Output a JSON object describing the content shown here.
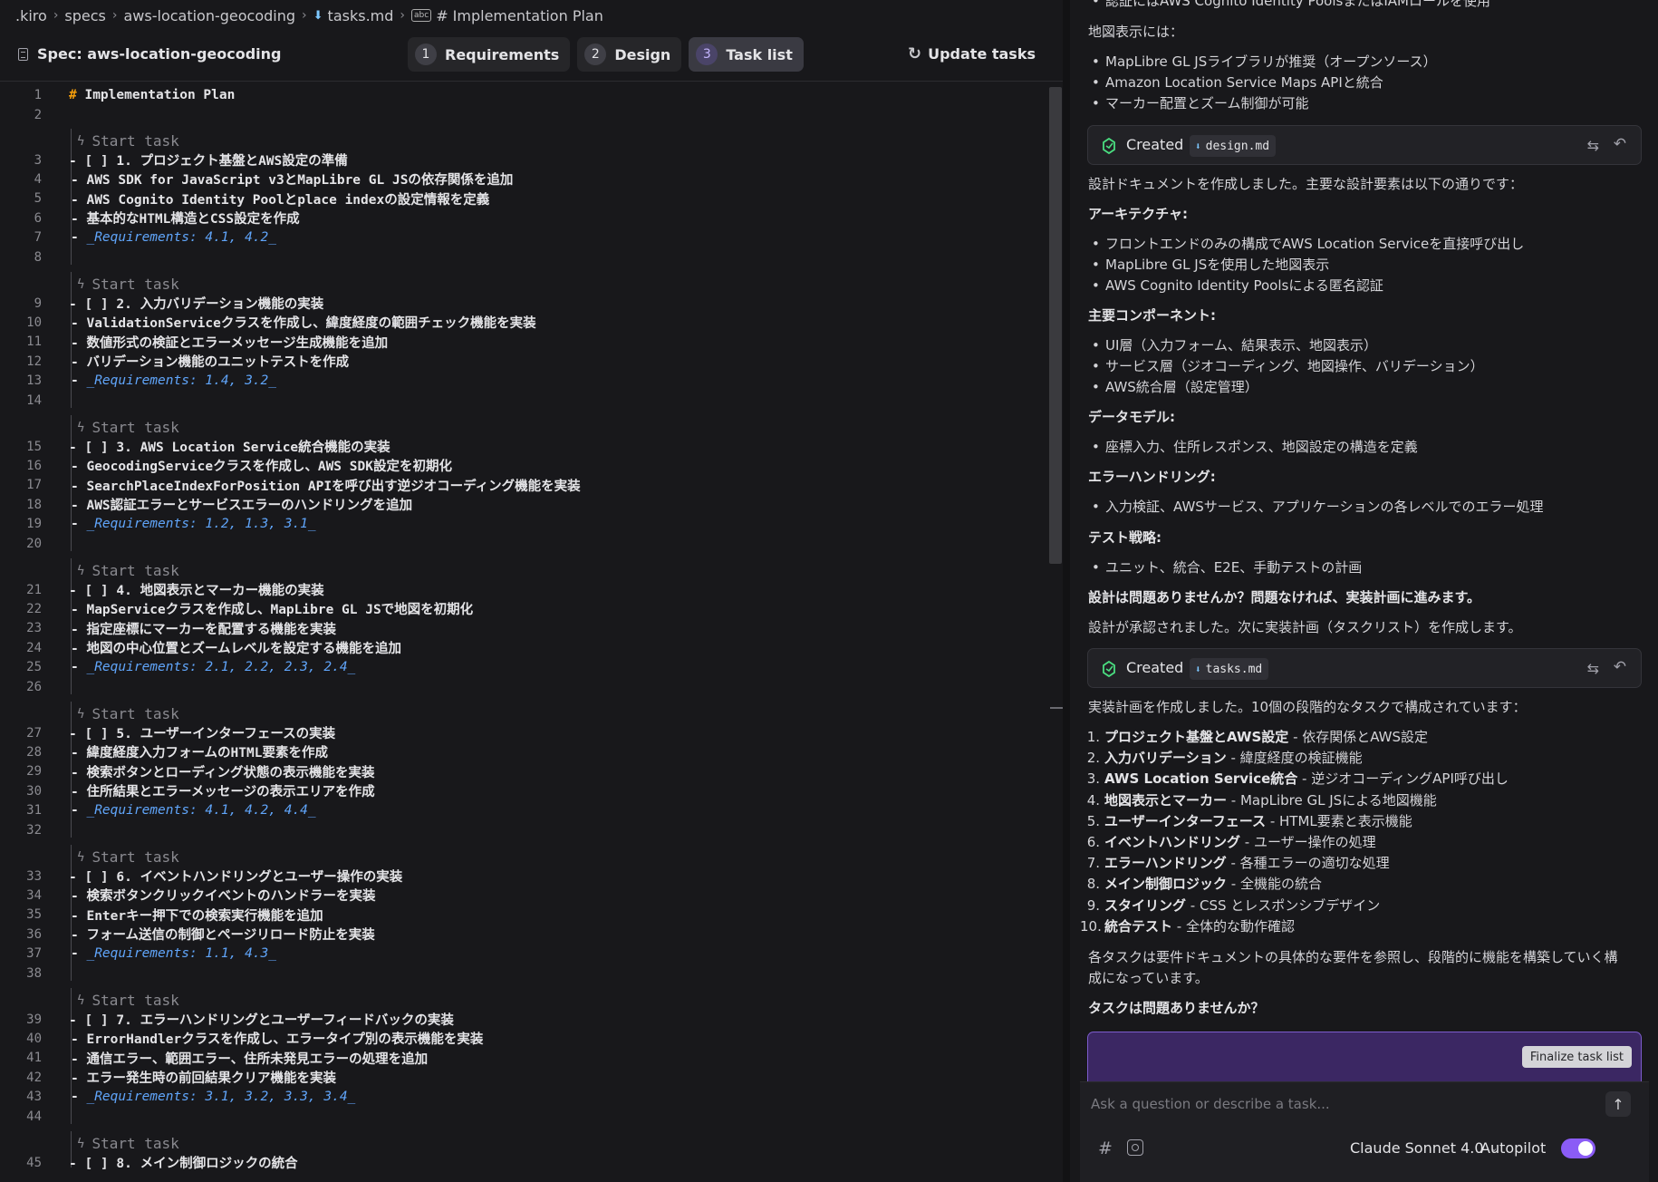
{
  "breadcrumb": [
    ".kiro",
    "specs",
    "aws-location-geocoding",
    "tasks.md",
    "# Implementation Plan"
  ],
  "spec": {
    "title": "Spec: aws-location-geocoding",
    "tabs": [
      {
        "num": "1",
        "label": "Requirements"
      },
      {
        "num": "2",
        "label": "Design"
      },
      {
        "num": "3",
        "label": "Task list"
      }
    ],
    "update_label": "Update tasks"
  },
  "editor": {
    "codelens": "Start task",
    "lines": [
      {
        "n": "1",
        "text": "# Implementation Plan"
      },
      {
        "n": "2",
        "text": ""
      },
      {
        "n": "3",
        "text": "- [ ] 1. プロジェクト基盤とAWS設定の準備"
      },
      {
        "n": "4",
        "text": "- AWS SDK for JavaScript v3とMapLibre GL JSの依存関係を追加"
      },
      {
        "n": "5",
        "text": "- AWS Cognito Identity Poolとplace indexの設定情報を定義"
      },
      {
        "n": "6",
        "text": "- 基本的なHTML構造とCSS設定を作成"
      },
      {
        "n": "7",
        "text": "_Requirements: 4.1, 4.2_"
      },
      {
        "n": "8",
        "text": ""
      },
      {
        "n": "9",
        "text": "- [ ] 2. 入力バリデーション機能の実装"
      },
      {
        "n": "10",
        "text": "- ValidationServiceクラスを作成し、緯度経度の範囲チェック機能を実装"
      },
      {
        "n": "11",
        "text": "- 数値形式の検証とエラーメッセージ生成機能を追加"
      },
      {
        "n": "12",
        "text": "- バリデーション機能のユニットテストを作成"
      },
      {
        "n": "13",
        "text": "_Requirements: 1.4, 3.2_"
      },
      {
        "n": "14",
        "text": ""
      },
      {
        "n": "15",
        "text": "- [ ] 3. AWS Location Service統合機能の実装"
      },
      {
        "n": "16",
        "text": "- GeocodingServiceクラスを作成し、AWS SDK設定を初期化"
      },
      {
        "n": "17",
        "text": "- SearchPlaceIndexForPosition APIを呼び出す逆ジオコーディング機能を実装"
      },
      {
        "n": "18",
        "text": "- AWS認証エラーとサービスエラーのハンドリングを追加"
      },
      {
        "n": "19",
        "text": "_Requirements: 1.2, 1.3, 3.1_"
      },
      {
        "n": "20",
        "text": ""
      },
      {
        "n": "21",
        "text": "- [ ] 4. 地図表示とマーカー機能の実装"
      },
      {
        "n": "22",
        "text": "- MapServiceクラスを作成し、MapLibre GL JSで地図を初期化"
      },
      {
        "n": "23",
        "text": "- 指定座標にマーカーを配置する機能を実装"
      },
      {
        "n": "24",
        "text": "- 地図の中心位置とズームレベルを設定する機能を追加"
      },
      {
        "n": "25",
        "text": "_Requirements: 2.1, 2.2, 2.3, 2.4_"
      },
      {
        "n": "26",
        "text": ""
      },
      {
        "n": "27",
        "text": "- [ ] 5. ユーザーインターフェースの実装"
      },
      {
        "n": "28",
        "text": "- 緯度経度入力フォームのHTML要素を作成"
      },
      {
        "n": "29",
        "text": "- 検索ボタンとローディング状態の表示機能を実装"
      },
      {
        "n": "30",
        "text": "- 住所結果とエラーメッセージの表示エリアを作成"
      },
      {
        "n": "31",
        "text": "_Requirements: 4.1, 4.2, 4.4_"
      },
      {
        "n": "32",
        "text": ""
      },
      {
        "n": "33",
        "text": "- [ ] 6. イベントハンドリングとユーザー操作の実装"
      },
      {
        "n": "34",
        "text": "- 検索ボタンクリックイベントのハンドラーを実装"
      },
      {
        "n": "35",
        "text": "- Enterキー押下での検索実行機能を追加"
      },
      {
        "n": "36",
        "text": "- フォーム送信の制御とページリロード防止を実装"
      },
      {
        "n": "37",
        "text": "_Requirements: 1.1, 4.3_"
      },
      {
        "n": "38",
        "text": ""
      },
      {
        "n": "39",
        "text": "- [ ] 7. エラーハンドリングとユーザーフィードバックの実装"
      },
      {
        "n": "40",
        "text": "- ErrorHandlerクラスを作成し、エラータイプ別の表示機能を実装"
      },
      {
        "n": "41",
        "text": "- 通信エラー、範囲エラー、住所未発見エラーの処理を追加"
      },
      {
        "n": "42",
        "text": "- エラー発生時の前回結果クリア機能を実装"
      },
      {
        "n": "43",
        "text": "_Requirements: 3.1, 3.2, 3.3, 3.4_"
      },
      {
        "n": "44",
        "text": ""
      },
      {
        "n": "45",
        "text": "- [ ] 8. メイン制御ロジックの統合"
      }
    ]
  },
  "chat": {
    "top_cut": "認証にはAWS Cognito Identity PoolsまたはIAMロールを使用",
    "map_display_label": "地図表示には：",
    "map_bullets": [
      "MapLibre GL JSライブラリが推奨（オープンソース）",
      "Amazon Location Service Maps APIと統合",
      "マーカー配置とズーム制御が可能"
    ],
    "created_label": "Created",
    "created_design_file": "design.md",
    "design_summary": "設計ドキュメントを作成しました。主要な設計要素は以下の通りです：",
    "arch_heading": "アーキテクチャ:",
    "arch_bullets": [
      "フロントエンドのみの構成でAWS Location Serviceを直接呼び出し",
      "MapLibre GL JSを使用した地図表示",
      "AWS Cognito Identity Poolsによる匿名認証"
    ],
    "comp_heading": "主要コンポーネント:",
    "comp_bullets": [
      "UI層（入力フォーム、結果表示、地図表示）",
      "サービス層（ジオコーディング、地図操作、バリデーション）",
      "AWS統合層（設定管理）"
    ],
    "model_heading": "データモデル:",
    "model_bullets": [
      "座標入力、住所レスポンス、地図設定の構造を定義"
    ],
    "err_heading": "エラーハンドリング:",
    "err_bullets": [
      "入力検証、AWSサービス、アプリケーションの各レベルでのエラー処理"
    ],
    "test_heading": "テスト戦略:",
    "test_bullets": [
      "ユニット、統合、E2E、手動テストの計画"
    ],
    "design_question": "設計は問題ありませんか？問題なければ、実装計画に進みます。",
    "design_approved": "設計が承認されました。次に実装計画（タスクリスト）を作成します。",
    "created_tasks_file": "tasks.md",
    "plan_summary": "実装計画を作成しました。10個の段階的なタスクで構成されています：",
    "tasks": [
      {
        "n": "1.",
        "title": "プロジェクト基盤とAWS設定",
        "desc": " - 依存関係とAWS設定"
      },
      {
        "n": "2.",
        "title": "入力バリデーション",
        "desc": " - 緯度経度の検証機能"
      },
      {
        "n": "3.",
        "title": "AWS Location Service統合",
        "desc": " - 逆ジオコーディングAPI呼び出し"
      },
      {
        "n": "4.",
        "title": "地図表示とマーカー",
        "desc": " - MapLibre GL JSによる地図機能"
      },
      {
        "n": "5.",
        "title": "ユーザーインターフェース",
        "desc": " - HTML要素と表示機能"
      },
      {
        "n": "6.",
        "title": "イベントハンドリング",
        "desc": " - ユーザー操作の処理"
      },
      {
        "n": "7.",
        "title": "エラーハンドリング",
        "desc": " - 各種エラーの適切な処理"
      },
      {
        "n": "8.",
        "title": "メイン制御ロジック",
        "desc": " - 全機能の統合"
      },
      {
        "n": "9.",
        "title": "スタイリング",
        "desc": " - CSS とレスポンシブデザイン"
      },
      {
        "n": "10.",
        "title": "統合テスト",
        "desc": " - 全体的な動作確認"
      }
    ],
    "closing_1": "各タスクは要件ドキュメントの具体的な要件を参照し、段階的に機能を構築していく構",
    "closing_2": "成になっています。",
    "task_question": "タスクは問題ありませんか？",
    "finalize_label": "Finalize task list",
    "input_placeholder": "Ask a question or describe a task...",
    "model_name": "Claude Sonnet 4.0",
    "autopilot_label": "Autopilot"
  }
}
